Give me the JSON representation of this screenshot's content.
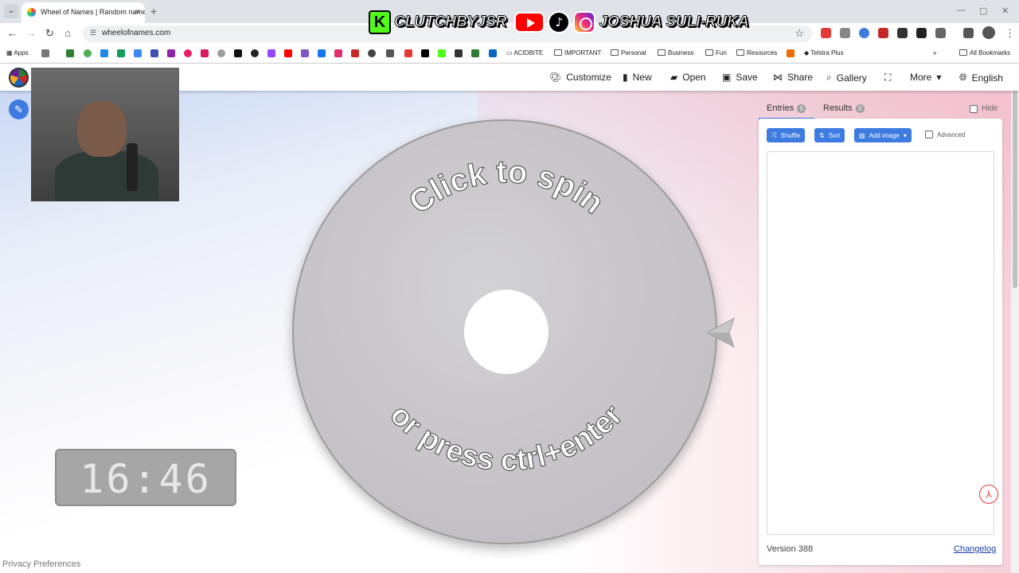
{
  "browser": {
    "tab_title": "Wheel of Names | Random name picker",
    "url": "wheelofnames.com",
    "bookmarks": [
      "Apps",
      "ACIDBITE",
      "IMPORTANT",
      "Personal",
      "Business",
      "Fun",
      "Resources",
      "Telstra Plus",
      "All Bookmarks"
    ]
  },
  "overlay": {
    "handle_kick": "CLUTCHBYJSR",
    "handle_social": "JOSHUA SULI-RUKA",
    "kick_letter": "K"
  },
  "header": {
    "customize": "Customize",
    "new": "New",
    "open": "Open",
    "save": "Save",
    "share": "Share",
    "gallery": "Gallery",
    "more": "More",
    "language": "English"
  },
  "wheel": {
    "line1": "Click to spin",
    "line2": "or press ctrl+enter"
  },
  "clock": "16:46",
  "footer": {
    "privacy": "Privacy Preferences"
  },
  "panel": {
    "entries_tab": "Entries",
    "entries_count": "0",
    "results_tab": "Results",
    "results_count": "0",
    "hide": "Hide",
    "shuffle": "Shuffle",
    "sort": "Sort",
    "add_image": "Add image",
    "advanced": "Advanced",
    "version": "Version 388",
    "changelog": "Changelog"
  },
  "colors": {
    "accent": "#3d7be0",
    "kick_green": "#53fc18",
    "youtube_red": "#ff0000"
  }
}
